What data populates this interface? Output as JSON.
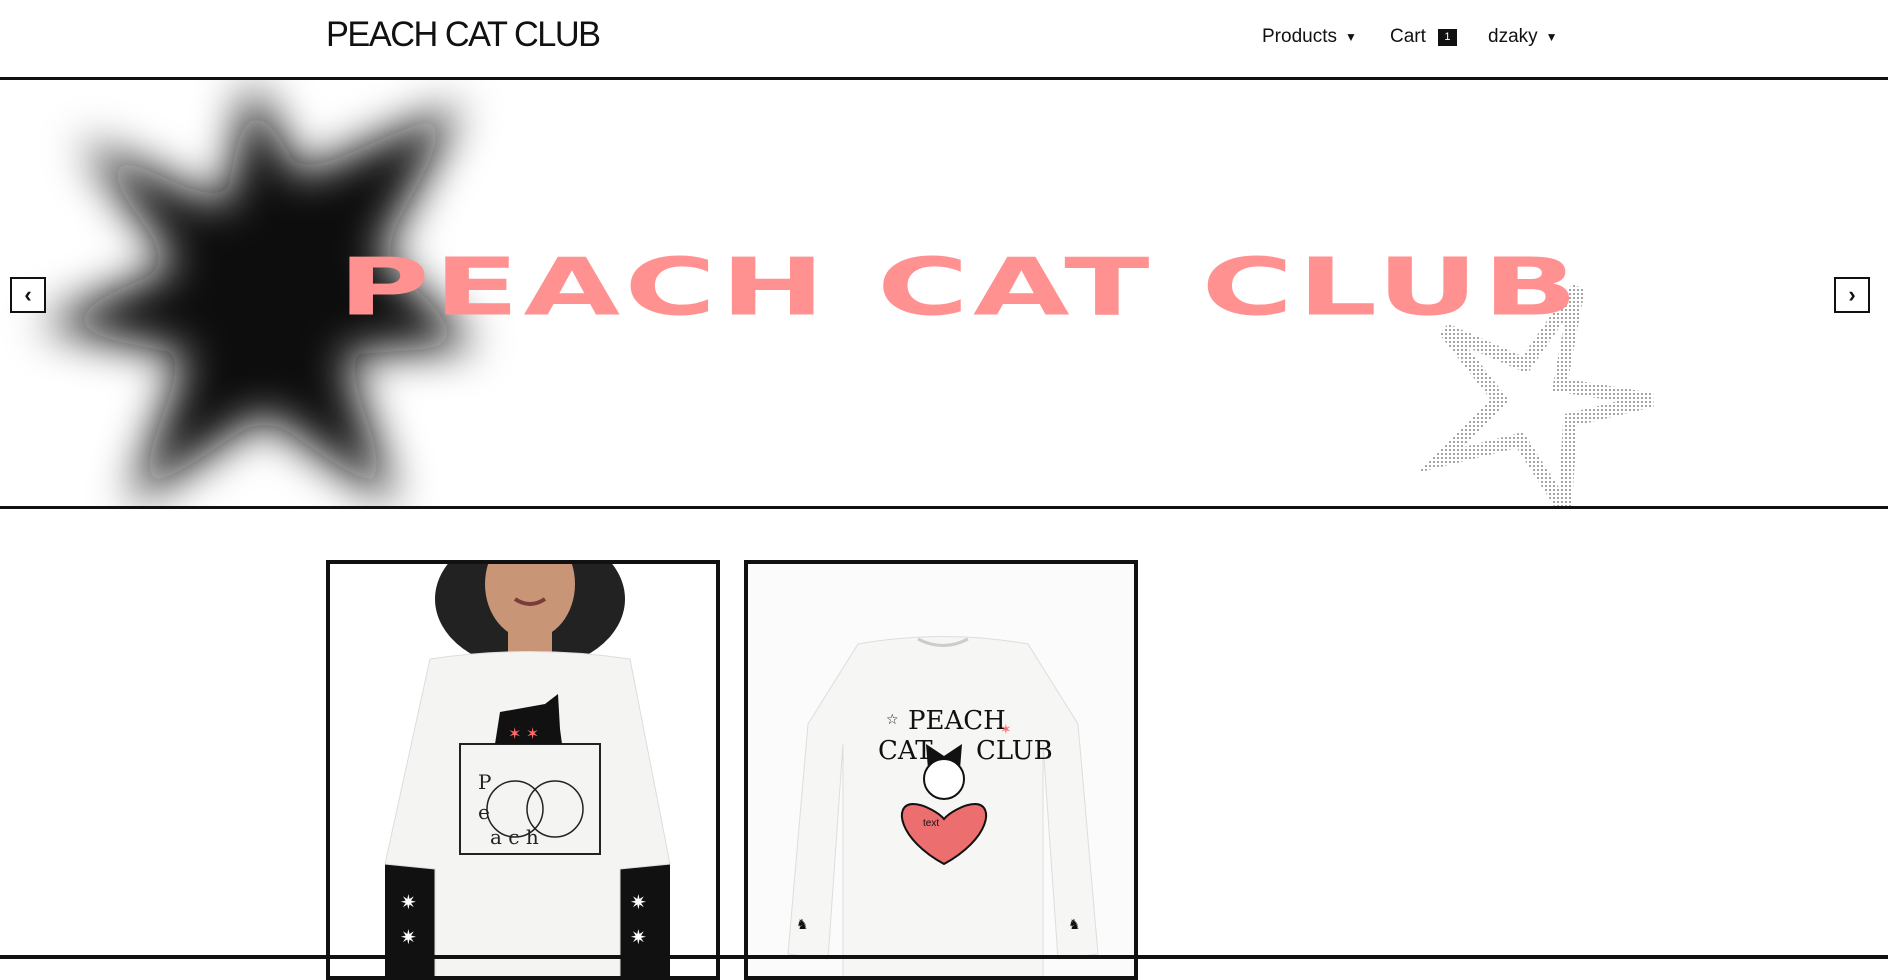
{
  "header": {
    "logo": "PEACH CAT CLUB",
    "nav": {
      "products": "Products",
      "cart": "Cart",
      "cart_count": "1",
      "user": "dzaky"
    }
  },
  "hero": {
    "title": "PEACH CAT CLUB",
    "prev_label": "‹",
    "next_label": "›",
    "icons": [
      "blurred-star-shape",
      "outline-star-shape"
    ]
  },
  "products": {
    "items": [
      {
        "image": "white-tshirt-cat-peach-box-model"
      },
      {
        "image": "white-longsleeve-peach-cat-club"
      }
    ]
  },
  "colors": {
    "accent": "#ff9191",
    "border": "#111111",
    "background": "#ffffff"
  }
}
